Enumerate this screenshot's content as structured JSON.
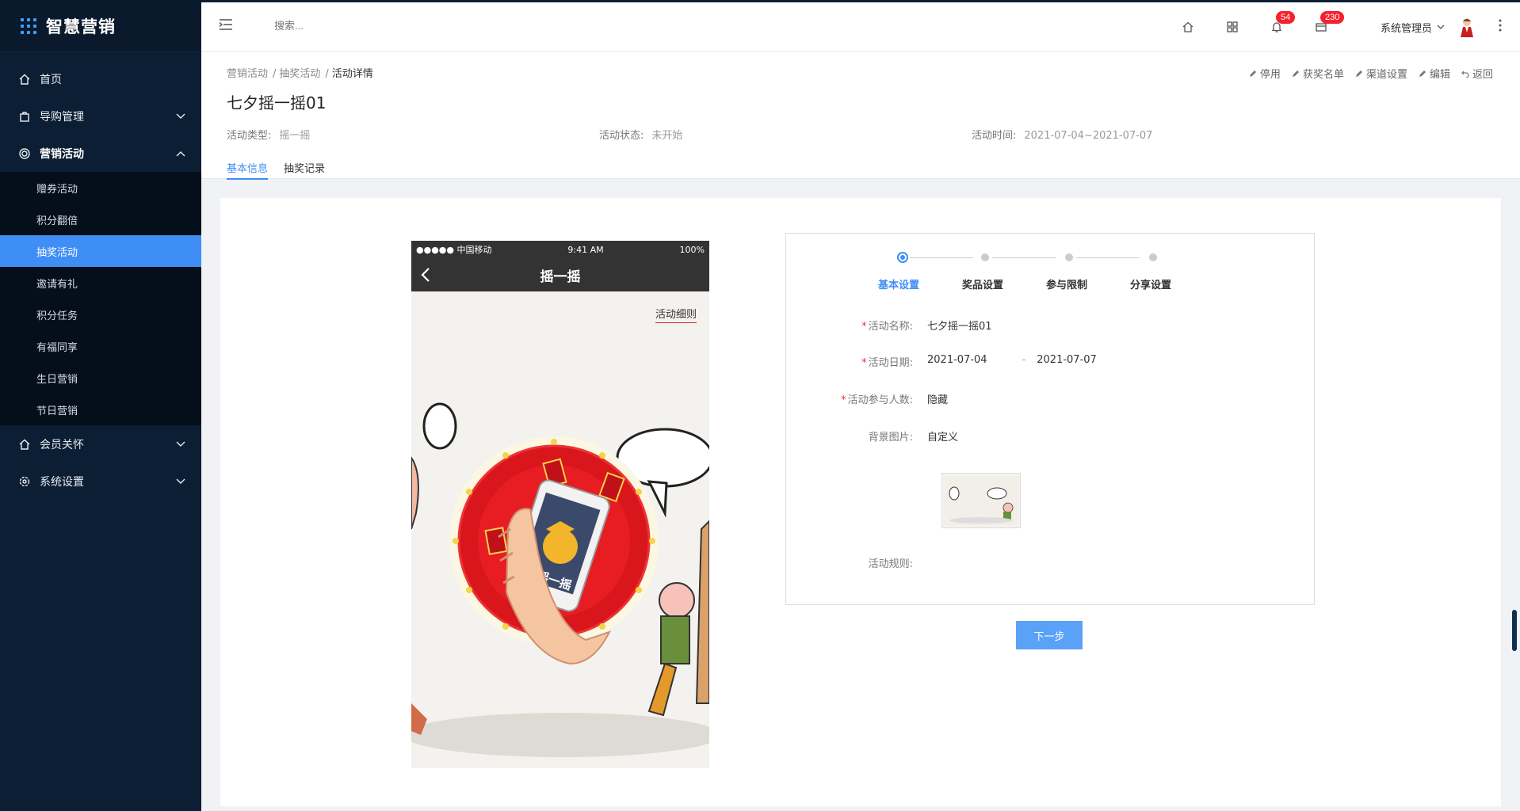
{
  "app": {
    "logo_text": "智慧营销"
  },
  "sidebar": {
    "items": [
      {
        "label": "首页",
        "icon": "home-icon"
      },
      {
        "label": "导购管理",
        "icon": "bag-icon"
      },
      {
        "label": "营销活动",
        "icon": "target-icon"
      },
      {
        "label": "会员关怀",
        "icon": "home-icon"
      },
      {
        "label": "系统设置",
        "icon": "gear-icon"
      }
    ],
    "subitems": [
      "赠券活动",
      "积分翻倍",
      "抽奖活动",
      "邀请有礼",
      "积分任务",
      "有福同享",
      "生日营销",
      "节日营销"
    ]
  },
  "header": {
    "search_placeholder": "搜索...",
    "bell_badge": "54",
    "mail_badge": "230",
    "user_name": "系统管理员"
  },
  "page": {
    "breadcrumb": [
      "营销活动",
      "抽奖活动",
      "活动详情"
    ],
    "actions": [
      "停用",
      "获奖名单",
      "渠道设置",
      "编辑",
      "返回"
    ],
    "title": "七夕摇一摇01",
    "meta": {
      "type_label": "活动类型:",
      "type_value": "摇一摇",
      "status_label": "活动状态:",
      "status_value": "未开始",
      "time_label": "活动时间:",
      "time_value": "2021-07-04~2021-07-07"
    },
    "tabs": [
      "基本信息",
      "抽奖记录"
    ]
  },
  "phone": {
    "carrier": "●●●●● 中国移动",
    "time": "9:41 AM",
    "battery": "100%",
    "nav_title": "摇一摇",
    "rules_link": "活动细则",
    "wheel_text": "摇一摇"
  },
  "form": {
    "steps": [
      "基本设置",
      "奖品设置",
      "参与限制",
      "分享设置"
    ],
    "active_step": 0,
    "name_label": "活动名称:",
    "name_value": "七夕摇一摇01",
    "date_label": "活动日期:",
    "date_start": "2021-07-04",
    "date_sep": "-",
    "date_end": "2021-07-07",
    "count_label": "活动参与人数:",
    "count_value": "隐藏",
    "bg_label": "背景图片:",
    "bg_value": "自定义",
    "rules_label": "活动规则:",
    "next_button": "下一步"
  },
  "colors": {
    "sidebar_bg": "#0c1e33",
    "accent": "#3f8ef6",
    "badge": "#f5222d"
  }
}
